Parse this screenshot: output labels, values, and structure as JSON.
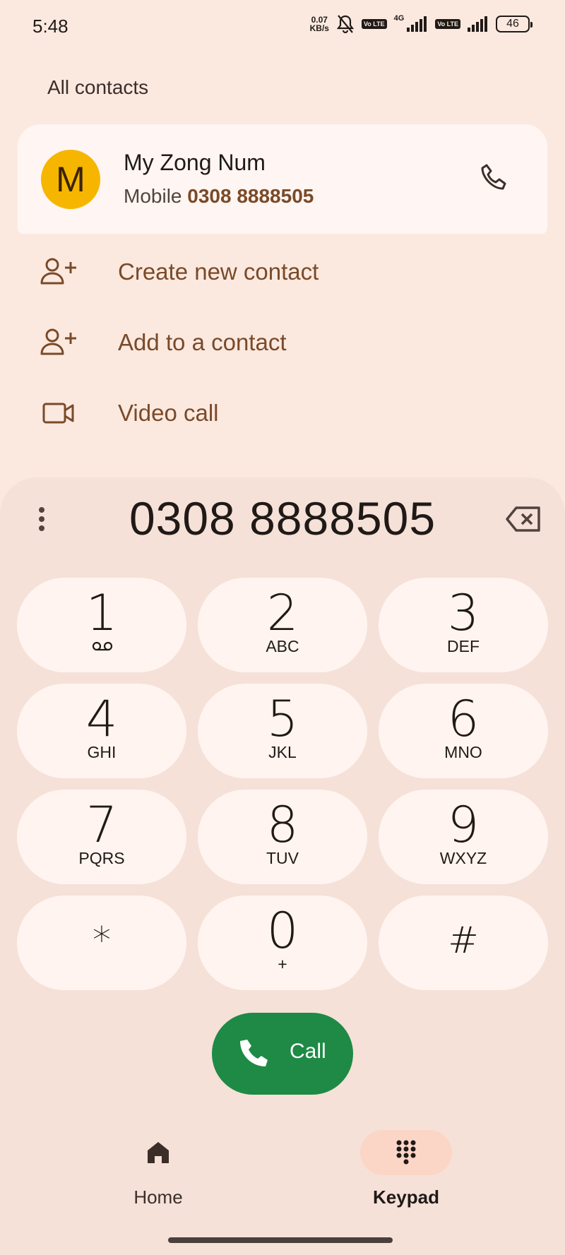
{
  "status_bar": {
    "time": "5:48",
    "net_speed_value": "0.07",
    "net_speed_unit": "KB/s",
    "volte1": "Vo LTE",
    "network_type": "4G",
    "volte2": "Vo LTE",
    "battery": "46",
    "icons": [
      "bell-off-icon",
      "signal-icon",
      "signal-icon",
      "battery-icon"
    ]
  },
  "header": {
    "title": "All contacts"
  },
  "contact": {
    "avatar_letter": "M",
    "name": "My Zong Num",
    "type_label": "Mobile",
    "number": "0308 8888505",
    "avatar_color": "#f6b600"
  },
  "actions": [
    {
      "label": "Create new contact",
      "icon": "person-add-icon"
    },
    {
      "label": "Add to a contact",
      "icon": "person-add-icon"
    },
    {
      "label": "Video call",
      "icon": "video-call-icon"
    }
  ],
  "dialer": {
    "number": "0308 8888505",
    "keys": [
      {
        "digit": "1",
        "letters": ""
      },
      {
        "digit": "2",
        "letters": "ABC"
      },
      {
        "digit": "3",
        "letters": "DEF"
      },
      {
        "digit": "4",
        "letters": "GHI"
      },
      {
        "digit": "5",
        "letters": "JKL"
      },
      {
        "digit": "6",
        "letters": "MNO"
      },
      {
        "digit": "7",
        "letters": "PQRS"
      },
      {
        "digit": "8",
        "letters": "TUV"
      },
      {
        "digit": "9",
        "letters": "WXYZ"
      },
      {
        "digit": "*",
        "letters": ""
      },
      {
        "digit": "0",
        "letters": "+"
      },
      {
        "digit": "#",
        "letters": ""
      }
    ],
    "call_label": "Call",
    "call_color": "#1e8a45"
  },
  "nav": {
    "home_label": "Home",
    "keypad_label": "Keypad",
    "active": "Keypad"
  }
}
